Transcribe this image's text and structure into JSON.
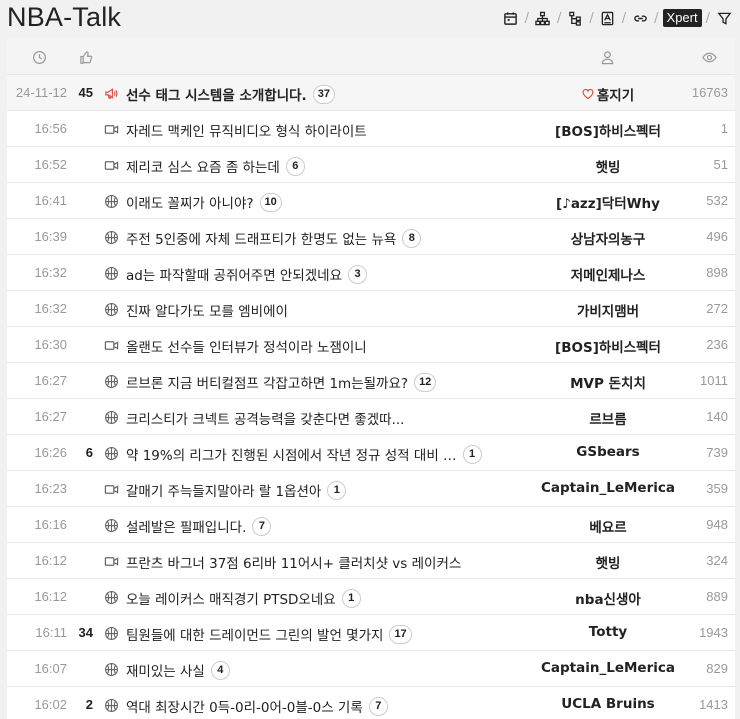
{
  "board": {
    "title": "NBA-Talk"
  },
  "toolbar": {
    "tools": [
      "calendar-icon",
      "hierarchy-icon",
      "tree-icon",
      "image-box-icon",
      "link-icon"
    ],
    "xpert_label": "Xpert",
    "filter_icon": "filter-icon"
  },
  "columns": {
    "time_icon": "clock-icon",
    "likes_icon": "thumbs-up-icon",
    "author_icon": "user-icon",
    "views_icon": "eye-icon"
  },
  "colors": {
    "notice_icon": "#d9534f",
    "heart": "#d9534f",
    "muted": "#999999"
  },
  "posts": [
    {
      "time": "24-11-12",
      "likes": "45",
      "category": "megaphone-icon",
      "title": "선수 태그 시스템을 소개합니다.",
      "comments": "37",
      "author": "홈지기",
      "author_badge": "heart-icon",
      "views": "16763",
      "notice": true
    },
    {
      "time": "16:56",
      "likes": "",
      "category": "video-icon",
      "title": "자레드 맥케인 뮤직비디오 형식 하이라이트",
      "comments": "",
      "author": "[BOS]하비스펙터",
      "views": "1"
    },
    {
      "time": "16:52",
      "likes": "",
      "category": "video-icon",
      "title": "제리코 심스 요즘 좀 하는데",
      "comments": "6",
      "author": "햇빙",
      "views": "51"
    },
    {
      "time": "16:41",
      "likes": "",
      "category": "basketball-icon",
      "title": "이래도 꼴찌가 아니야?",
      "comments": "10",
      "author": "[♪azz]닥터Why",
      "views": "532"
    },
    {
      "time": "16:39",
      "likes": "",
      "category": "basketball-icon",
      "title": "주전 5인중에 자체 드래프티가 한명도 없는 뉴욕",
      "comments": "8",
      "author": "상남자의농구",
      "views": "496"
    },
    {
      "time": "16:32",
      "likes": "",
      "category": "basketball-icon",
      "title": "ad는 파작할때 공쥐어주면 안되겠네요",
      "comments": "3",
      "author": "저메인제나스",
      "views": "898"
    },
    {
      "time": "16:32",
      "likes": "",
      "category": "basketball-icon",
      "title": "진짜 알다가도 모를 엠비에이",
      "comments": "",
      "author": "가비지맴버",
      "views": "272"
    },
    {
      "time": "16:30",
      "likes": "",
      "category": "video-icon",
      "title": "올랜도 선수들 인터뷰가 정석이라 노잼이니",
      "comments": "",
      "author": "[BOS]하비스펙터",
      "views": "236"
    },
    {
      "time": "16:27",
      "likes": "",
      "category": "basketball-icon",
      "title": "르브론 지금 버티컬점프 각잡고하면 1m는될까요?",
      "comments": "12",
      "author": "MVP 돈치치",
      "views": "1011"
    },
    {
      "time": "16:27",
      "likes": "",
      "category": "basketball-icon",
      "title": "크리스티가 크넥트 공격능력을 갖춘다면 좋겠따...",
      "comments": "",
      "author": "르브름",
      "views": "140"
    },
    {
      "time": "16:26",
      "likes": "6",
      "category": "basketball-icon",
      "title": "약 19%의 리그가 진행된 시점에서 작년 정규 성적 대비 …",
      "comments": "1",
      "author": "GSbears",
      "views": "739"
    },
    {
      "time": "16:23",
      "likes": "",
      "category": "video-icon",
      "title": "갈매기 주늑들지말아라 랄 1옵션아",
      "comments": "1",
      "author": "Captain_LeMerica",
      "views": "359"
    },
    {
      "time": "16:16",
      "likes": "",
      "category": "basketball-icon",
      "title": "설레발은 필패입니다.",
      "comments": "7",
      "author": "베요르",
      "views": "948"
    },
    {
      "time": "16:12",
      "likes": "",
      "category": "video-icon",
      "title": "프란츠 바그너 37점 6리바 11어시+ 클러치샷 vs 레이커스",
      "comments": "",
      "author": "햇빙",
      "views": "324"
    },
    {
      "time": "16:12",
      "likes": "",
      "category": "basketball-icon",
      "title": "오늘 레이커스 매직경기 PTSD오네요",
      "comments": "1",
      "author": "nba신생아",
      "views": "889"
    },
    {
      "time": "16:11",
      "likes": "34",
      "category": "basketball-icon",
      "title": "팀원들에 대한 드레이먼드 그린의 발언 몇가지",
      "comments": "17",
      "author": "Totty",
      "views": "1943"
    },
    {
      "time": "16:07",
      "likes": "",
      "category": "basketball-icon",
      "title": "재미있는 사실",
      "comments": "4",
      "author": "Captain_LeMerica",
      "views": "829"
    },
    {
      "time": "16:02",
      "likes": "2",
      "category": "basketball-icon",
      "title": "역대 최장시간 0득-0리-0어-0블-0스 기록",
      "comments": "7",
      "author": "UCLA Bruins",
      "views": "1413"
    }
  ]
}
